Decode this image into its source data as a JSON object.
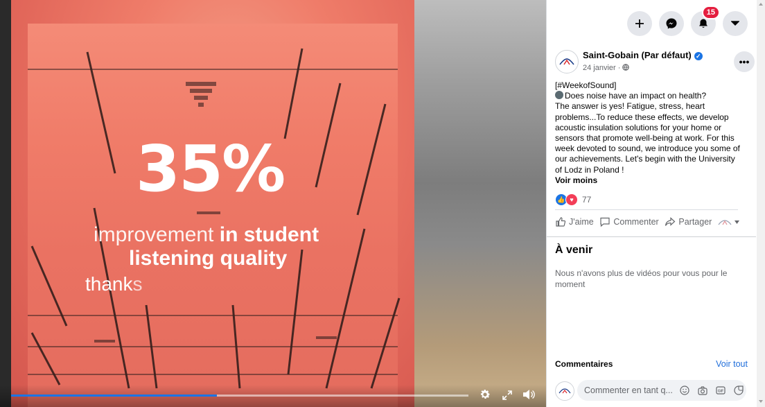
{
  "video": {
    "overlay": {
      "big_number": "35%",
      "line1_light": "improvement ",
      "line1_bold": "in student",
      "line2": "listening quality",
      "line3_solid": "thank",
      "line3_fade": "s"
    },
    "progress_fraction": 0.45,
    "controls": {
      "settings_icon": "gear-icon",
      "expand_icon": "expand-icon",
      "volume_icon": "volume-icon"
    }
  },
  "header": {
    "notification_count": "15",
    "icons": [
      "plus-icon",
      "messenger-icon",
      "bell-icon",
      "chevron-down-icon"
    ]
  },
  "post": {
    "page_name": "Saint-Gobain (Par défaut)",
    "date": "24 janvier ·",
    "paragraphs": [
      "[#WeekofSound]",
      "Does noise have an impact on health?",
      "The answer is yes! Fatigue, stress, heart problems...To reduce these effects, we develop acoustic insulation solutions for your home or sensors that promote well-being at work. For this week devoted to sound, we introduce you some of our achievements. Let's begin with the University of Lodz in Poland !"
    ],
    "see_less": "Voir moins",
    "reaction_count": "77",
    "actions": {
      "like": "J'aime",
      "comment": "Commenter",
      "share": "Partager"
    }
  },
  "up_next": {
    "title": "À venir",
    "empty_text": "Nous n'avons plus de vidéos pour vous pour le moment"
  },
  "comments": {
    "label": "Commentaires",
    "see_all": "Voir tout",
    "placeholder": "Commenter en tant q..."
  },
  "colors": {
    "accent": "#1b74e4",
    "notification": "#e41e3f",
    "overlay": "#ee7563"
  }
}
